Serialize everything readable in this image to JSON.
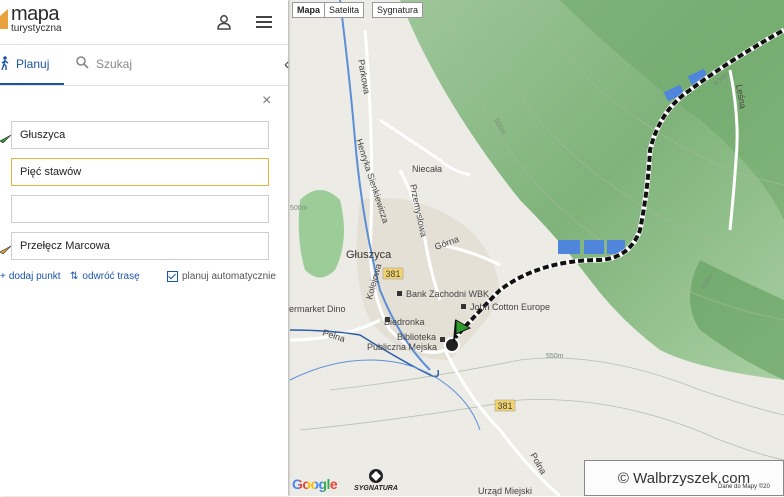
{
  "app": {
    "logo_title": "mapa",
    "logo_subtitle": "turystyczna"
  },
  "header": {
    "user_icon": "user-icon",
    "menu_icon": "hamburger-menu-icon"
  },
  "tabs": {
    "plan_label": "Planuj",
    "search_label": "Szukaj"
  },
  "route": {
    "fields": [
      {
        "value": "Głuszyca",
        "icon": "flag-green-icon"
      },
      {
        "value": "Pięć stawów",
        "icon": ""
      },
      {
        "value": "",
        "icon": ""
      },
      {
        "value": "Przełęcz Marcowa",
        "icon": "flag-orange-icon"
      }
    ],
    "add_point_label": "dodaj punkt",
    "reverse_label": "odwróć trasę",
    "auto_plan_label": "planuj automatycznie",
    "auto_plan_checked": true
  },
  "map": {
    "type_buttons": [
      "Mapa",
      "Satelita",
      "Sygnatura"
    ],
    "active_type": "Mapa",
    "town_label": "Głuszyca",
    "street_labels": [
      "Parkowa",
      "Henryka Sienkiewicza",
      "Niecała",
      "Przemysłowa",
      "Górna",
      "Kolejowa",
      "Pełna",
      "Leśna",
      "Polna"
    ],
    "poi_labels": [
      "Bank Zachodni WBK",
      "John Cotton Europe",
      "Biedronka",
      "Biblioteka",
      "Publiczna Mejska",
      "ermarket Dino",
      "Urząd Miejski"
    ],
    "road_numbers": [
      "381",
      "381"
    ],
    "contour_labels": [
      "500m",
      "550m",
      "500m",
      "600m",
      "600m"
    ],
    "route_color": "#111111",
    "google_label": "Google",
    "sygnatura_label": "SYGNATURA",
    "map_data_label": "Dane do Mapy ©20",
    "watermark": "© Walbrzyszek.com"
  },
  "colors": {
    "accent": "#1a55a7",
    "focus": "#e8b33c",
    "forest": "#8ec88a",
    "forest_light": "#b9dfb0",
    "river": "#5b8fd8"
  }
}
